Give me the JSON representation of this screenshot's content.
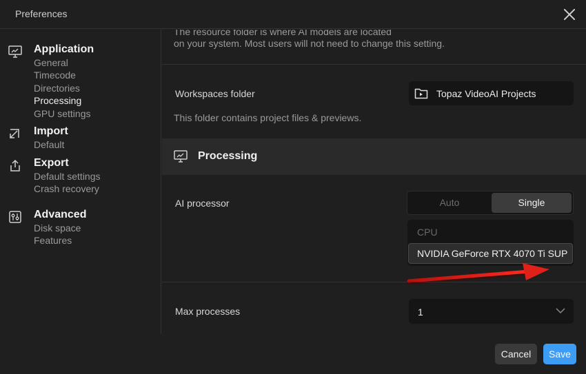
{
  "window": {
    "title": "Preferences"
  },
  "sidebar": {
    "groups": [
      {
        "title": "Application",
        "icon": "monitor-settings-icon",
        "items": [
          "General",
          "Timecode",
          "Directories",
          "Processing",
          "GPU settings"
        ],
        "active": "Processing"
      },
      {
        "title": "Import",
        "icon": "import-arrow-icon",
        "items": [
          "Default"
        ]
      },
      {
        "title": "Export",
        "icon": "export-share-icon",
        "items": [
          "Default settings",
          "Crash recovery"
        ]
      },
      {
        "title": "Advanced",
        "icon": "sliders-icon",
        "items": [
          "Disk space",
          "Features"
        ]
      }
    ]
  },
  "content": {
    "resource_folder_text_line1": "The resource folder is where AI models are located",
    "resource_folder_text_line2": "on your system. Most users will not need to change this setting.",
    "workspaces": {
      "label": "Workspaces folder",
      "value": "Topaz VideoAI Projects",
      "help": "This folder contains project files & previews."
    },
    "processing_section": {
      "title": "Processing"
    },
    "ai_processor": {
      "label": "AI processor",
      "options": [
        "Auto",
        "Single"
      ],
      "selected": "Single",
      "devices": [
        "CPU",
        "NVIDIA GeForce RTX 4070 Ti SUP"
      ],
      "selected_device": "NVIDIA GeForce RTX 4070 Ti SUP"
    },
    "max_processes": {
      "label": "Max processes",
      "value": "1"
    }
  },
  "footer": {
    "cancel_label": "Cancel",
    "save_label": "Save"
  },
  "colors": {
    "accent": "#3d9df5",
    "annotation_arrow": "#e0201a"
  }
}
